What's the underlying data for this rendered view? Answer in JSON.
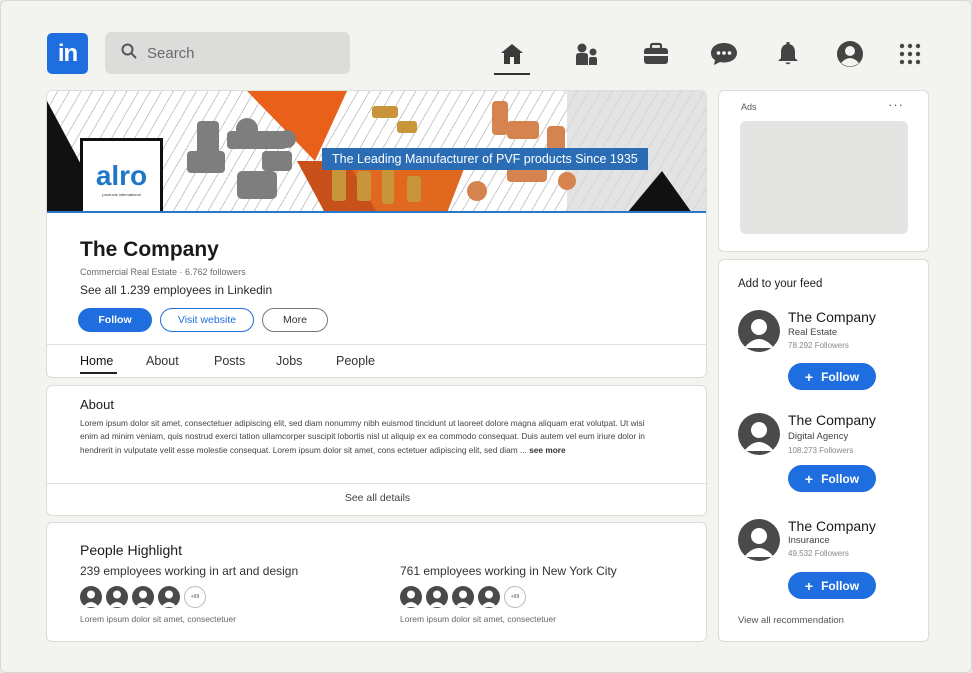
{
  "topbar": {
    "logo_text": "in",
    "search_placeholder": "Search",
    "nav_icons": [
      "home-icon",
      "people-icon",
      "briefcase-icon",
      "messaging-icon",
      "bell-icon",
      "profile-icon",
      "apps-grid-icon"
    ]
  },
  "banner": {
    "logo_word": "alro",
    "logo_subtitle": "products international",
    "tagline": "The Leading Manufacturer of PVF products Since 1935"
  },
  "company": {
    "name": "The Company",
    "meta": "Commercial Real Estate · 6.762 followers",
    "employees_link": "See all 1.239 employees in Linkedin",
    "buttons": {
      "follow": "Follow",
      "visit": "Visit website",
      "more": "More"
    },
    "tabs": [
      "Home",
      "About",
      "Posts",
      "Jobs",
      "People"
    ]
  },
  "about": {
    "title": "About",
    "text": "Lorem ipsum dolor sit amet, consectetuer adipiscing elit, sed diam nonummy nibh euismod tincidunt ut laoreet dolore magna aliquam erat volutpat. Ut wisi enim ad minim veniam, quis nostrud exerci tation ullamcorper suscipit lobortis nisl ut aliquip ex ea commodo consequat. Duis autem vel eum iriure dolor in hendrerit in vulputate velit esse molestie consequat. Lorem ipsum dolor sit amet, cons ectetuer adipiscing elit, sed diam ...",
    "see_more": "see more",
    "see_all": "See all details"
  },
  "people_highlight": {
    "title": "People Highlight",
    "groups": [
      {
        "text": "239 employees working in art and design",
        "more": "+99",
        "caption": "Lorem ipsum dolor sit amet, consectetuer"
      },
      {
        "text": "761 employees working in New York City",
        "more": "+99",
        "caption": "Lorem ipsum dolor sit amet, consectetuer"
      }
    ]
  },
  "ads": {
    "label": "Ads",
    "menu": "···"
  },
  "feed": {
    "title": "Add to your feed",
    "follow_label": "Follow",
    "items": [
      {
        "name": "The Company",
        "industry": "Real Estate",
        "followers": "78.292 Followers"
      },
      {
        "name": "The Company",
        "industry": "Digital Agency",
        "followers": "108.273 Followers"
      },
      {
        "name": "The Company",
        "industry": "Insurance",
        "followers": "49.532 Followers"
      }
    ],
    "view_all": "View all recommendation"
  },
  "colors": {
    "accent": "#1f6ee0",
    "banner_orange": "#e8601a",
    "tagline_bg": "#2a6db5",
    "page_bg": "#f3f3f0"
  }
}
